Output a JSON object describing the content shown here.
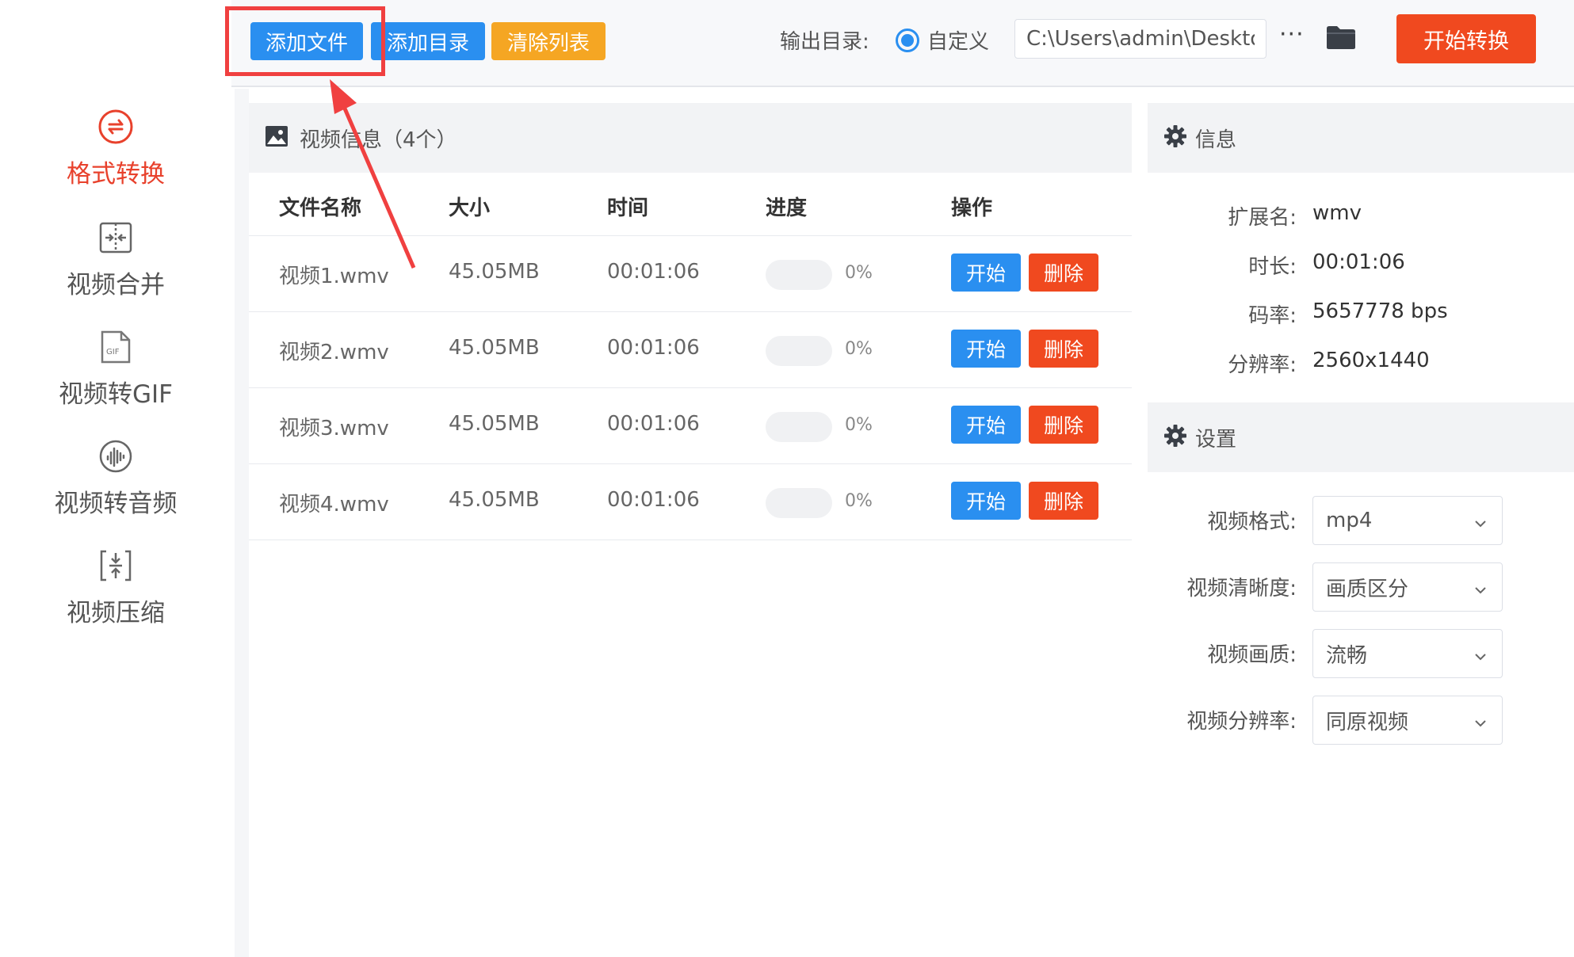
{
  "sidebar": {
    "items": [
      {
        "label": "格式转换",
        "icon": "format-convert-icon",
        "active": true
      },
      {
        "label": "视频合并",
        "icon": "video-merge-icon",
        "active": false
      },
      {
        "label": "视频转GIF",
        "icon": "gif-icon",
        "active": false
      },
      {
        "label": "视频转音频",
        "icon": "audio-icon",
        "active": false
      },
      {
        "label": "视频压缩",
        "icon": "compress-icon",
        "active": false
      }
    ]
  },
  "toolbar": {
    "add_file": "添加文件",
    "add_dir": "添加目录",
    "clear_list": "清除列表",
    "output_label": "输出目录:",
    "radio_label": "自定义",
    "output_path": "C:\\Users\\admin\\Deskto",
    "more": "···",
    "start_convert": "开始转换"
  },
  "file_panel": {
    "title": "视频信息（4个）",
    "columns": [
      "文件名称",
      "大小",
      "时间",
      "进度",
      "操作"
    ],
    "rows": [
      {
        "name": "视频1.wmv",
        "size": "45.05MB",
        "time": "00:01:06",
        "progress": 0,
        "pct": "0%",
        "start": "开始",
        "delete": "删除"
      },
      {
        "name": "视频2.wmv",
        "size": "45.05MB",
        "time": "00:01:06",
        "progress": 0,
        "pct": "0%",
        "start": "开始",
        "delete": "删除"
      },
      {
        "name": "视频3.wmv",
        "size": "45.05MB",
        "time": "00:01:06",
        "progress": 0,
        "pct": "0%",
        "start": "开始",
        "delete": "删除"
      },
      {
        "name": "视频4.wmv",
        "size": "45.05MB",
        "time": "00:01:06",
        "progress": 0,
        "pct": "0%",
        "start": "开始",
        "delete": "删除"
      }
    ]
  },
  "info_panel": {
    "title": "信息",
    "items": [
      {
        "key": "扩展名:",
        "value": "wmv"
      },
      {
        "key": "时长:",
        "value": "00:01:06"
      },
      {
        "key": "码率:",
        "value": "5657778 bps"
      },
      {
        "key": "分辨率:",
        "value": "2560x1440"
      }
    ]
  },
  "settings_panel": {
    "title": "设置",
    "items": [
      {
        "label": "视频格式:",
        "value": "mp4"
      },
      {
        "label": "视频清晰度:",
        "value": "画质区分"
      },
      {
        "label": "视频画质:",
        "value": "流畅"
      },
      {
        "label": "视频分辨率:",
        "value": "同原视频"
      }
    ]
  },
  "colors": {
    "accent_blue": "#2a8ff0",
    "accent_red": "#f0491f",
    "accent_orange": "#f5a623",
    "active_text": "#e8412c",
    "annotation_red": "#f04040"
  }
}
